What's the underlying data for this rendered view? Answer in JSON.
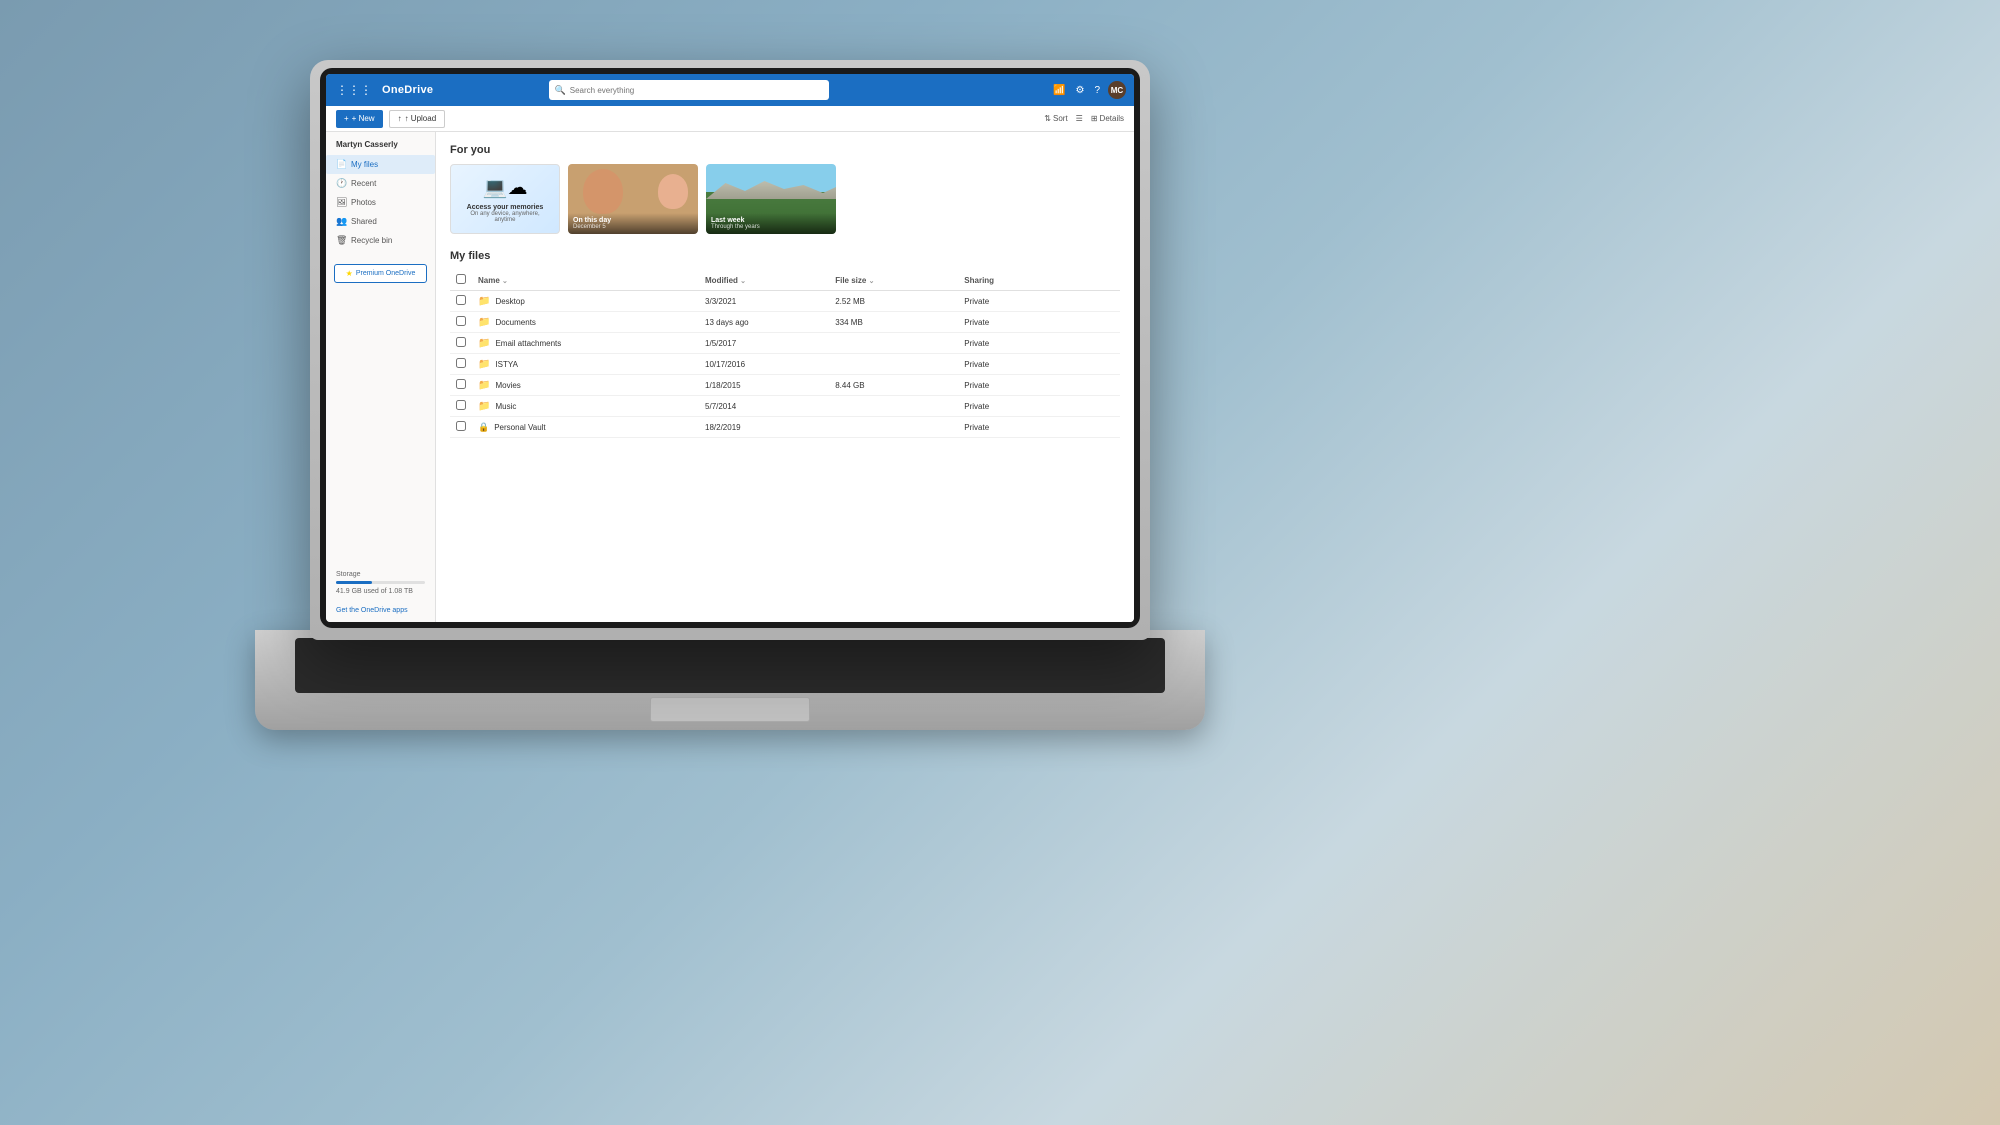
{
  "background": {
    "color": "#6b8a9e"
  },
  "header": {
    "logo": "OneDrive",
    "search_placeholder": "Search everything",
    "icons": [
      "wifi-icon",
      "settings-icon",
      "help-icon"
    ],
    "avatar_initials": "MC"
  },
  "toolbar": {
    "new_label": "+ New",
    "upload_label": "↑ Upload",
    "sort_label": "Sort",
    "view_label": "≡",
    "details_label": "Details"
  },
  "sidebar": {
    "user_name": "Martyn Casserly",
    "nav_items": [
      {
        "id": "my-files",
        "label": "My files",
        "icon": "📄",
        "active": true
      },
      {
        "id": "recent",
        "label": "Recent",
        "icon": "🕐"
      },
      {
        "id": "photos",
        "label": "Photos",
        "icon": "🖼"
      },
      {
        "id": "shared",
        "label": "Shared",
        "icon": "👥"
      },
      {
        "id": "recycle-bin",
        "label": "Recycle bin",
        "icon": "🗑"
      }
    ],
    "premium_label": "Premium OneDrive",
    "storage_label": "Storage",
    "storage_used": "41.9 GB used of 1.08 TB",
    "get_apps_label": "Get the OneDrive apps",
    "storage_percent": 40
  },
  "for_you": {
    "section_title": "For you",
    "cards": [
      {
        "id": "access-memories",
        "type": "promo",
        "title": "Access your memories",
        "subtitle": "On any device, anywhere, anytime"
      },
      {
        "id": "on-this-day",
        "type": "photo",
        "title": "On this day",
        "subtitle": "December 5"
      },
      {
        "id": "last-week",
        "type": "photo",
        "title": "Last week",
        "subtitle": "Through the years"
      }
    ]
  },
  "files": {
    "section_title": "My files",
    "columns": [
      {
        "id": "name",
        "label": "Name",
        "sortable": true
      },
      {
        "id": "modified",
        "label": "Modified",
        "sortable": true
      },
      {
        "id": "file-size",
        "label": "File size",
        "sortable": true
      },
      {
        "id": "sharing",
        "label": "Sharing",
        "sortable": false
      }
    ],
    "rows": [
      {
        "name": "Desktop",
        "type": "folder",
        "modified": "3/3/2021",
        "size": "2.52 MB",
        "sharing": "Private"
      },
      {
        "name": "Documents",
        "type": "folder",
        "modified": "13 days ago",
        "size": "334 MB",
        "sharing": "Private"
      },
      {
        "name": "Email attachments",
        "type": "folder",
        "modified": "1/5/2017",
        "size": "",
        "sharing": "Private"
      },
      {
        "name": "ISTYA",
        "type": "folder",
        "modified": "10/17/2016",
        "size": "",
        "sharing": "Private"
      },
      {
        "name": "Movies",
        "type": "folder",
        "modified": "1/18/2015",
        "size": "8.44 GB",
        "sharing": "Private"
      },
      {
        "name": "Music",
        "type": "folder",
        "modified": "5/7/2014",
        "size": "",
        "sharing": "Private"
      },
      {
        "name": "Personal Vault",
        "type": "vault",
        "modified": "18/2/2019",
        "size": "",
        "sharing": "Private"
      }
    ]
  }
}
